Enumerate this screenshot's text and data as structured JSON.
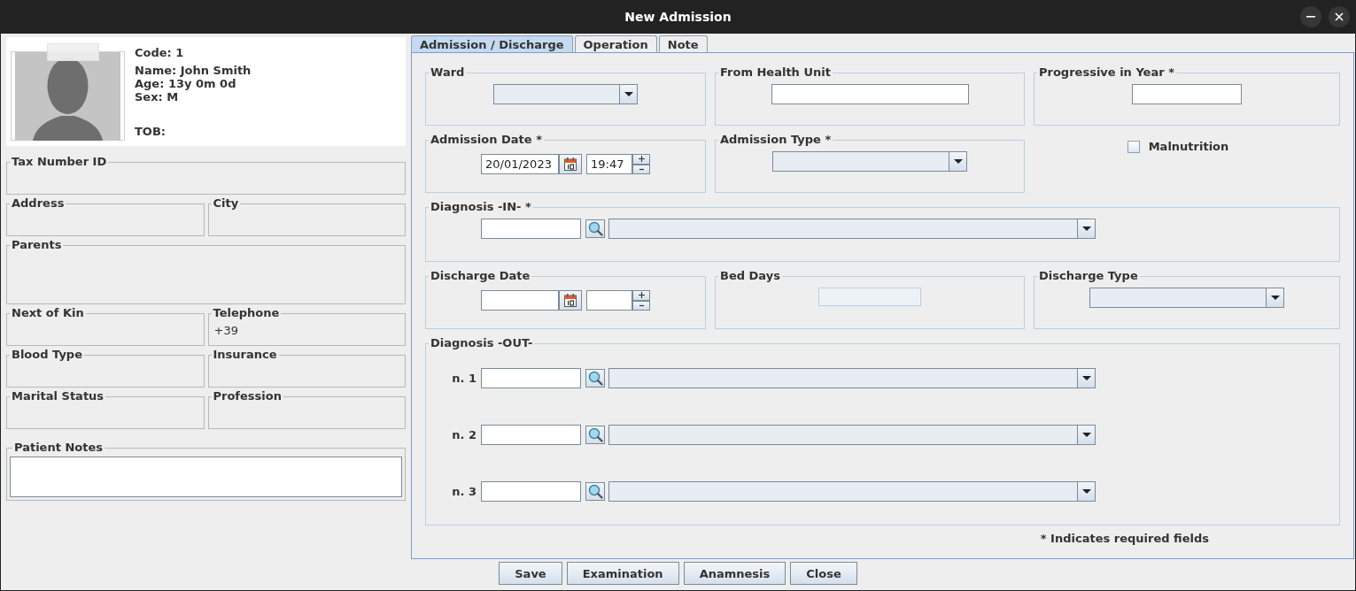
{
  "window": {
    "title": "New Admission"
  },
  "patient": {
    "code": "Code: 1",
    "name": "Name: John Smith",
    "age": "Age: 13y 0m 0d",
    "sex": "Sex: M",
    "tob": "TOB:"
  },
  "patient_rows": [
    [
      {
        "label": "Tax Number ID",
        "kind": "short"
      }
    ],
    [
      {
        "label": "Address",
        "kind": "short"
      },
      {
        "label": "City",
        "kind": "short"
      }
    ],
    [
      {
        "label": "Parents",
        "kind": "tall"
      }
    ],
    [
      {
        "label": "Next of Kin",
        "kind": "short"
      },
      {
        "label": "Telephone",
        "kind": "short",
        "value": "+39"
      }
    ],
    [
      {
        "label": "Blood Type",
        "kind": "short"
      },
      {
        "label": "Insurance",
        "kind": "short"
      }
    ],
    [
      {
        "label": "Marital Status",
        "kind": "short"
      },
      {
        "label": "Profession",
        "kind": "short"
      }
    ]
  ],
  "patient_notes": {
    "label": "Patient Notes"
  },
  "tabs": [
    {
      "label": "Admission / Discharge",
      "selected": true
    },
    {
      "label": "Operation",
      "selected": false
    },
    {
      "label": "Note",
      "selected": false
    }
  ],
  "ward": {
    "label": "Ward"
  },
  "from_health_unit": {
    "label": "From Health Unit"
  },
  "progressive_in_year": {
    "label": "Progressive in Year *"
  },
  "admission_date": {
    "label": "Admission Date *",
    "date": "20/01/2023",
    "time": "19:47"
  },
  "admission_type": {
    "label": "Admission Type *"
  },
  "malnutrition": {
    "label": "Malnutrition",
    "checked": false
  },
  "diagnosis_in": {
    "label": "Diagnosis -IN- *"
  },
  "discharge_date": {
    "label": "Discharge Date"
  },
  "bed_days": {
    "label": "Bed Days"
  },
  "discharge_type": {
    "label": "Discharge Type"
  },
  "diagnosis_out": {
    "label": "Diagnosis -OUT-",
    "rows": [
      {
        "label": "n. 1"
      },
      {
        "label": "n. 2"
      },
      {
        "label": "n. 3"
      }
    ]
  },
  "required_note": "* Indicates required fields",
  "buttons": [
    "Save",
    "Examination",
    "Anamnesis",
    "Close"
  ]
}
